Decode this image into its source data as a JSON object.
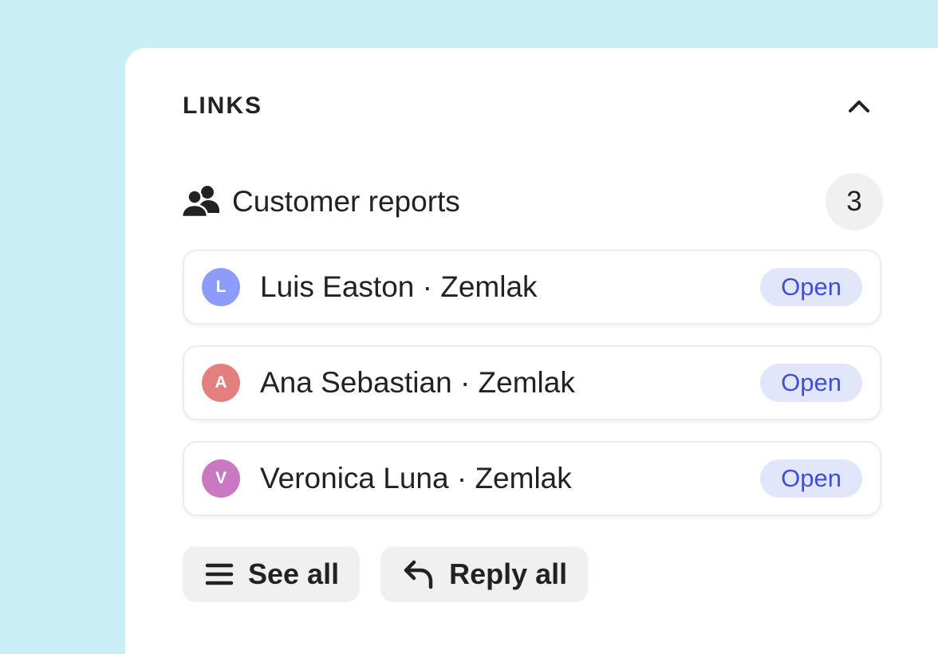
{
  "colors": {
    "page_background": "#c9eef5",
    "panel_background": "#ffffff",
    "open_button_bg": "#e1e6fb",
    "open_button_text": "#3d50d6",
    "action_button_bg": "#f0f0f0"
  },
  "section": {
    "title": "LINKS",
    "collapse_icon": "chevron-up-icon"
  },
  "group": {
    "icon": "users-icon",
    "title": "Customer reports",
    "count": "3"
  },
  "reports": [
    {
      "initial": "L",
      "avatar_color": "#8e9cf9",
      "name": "Luis Easton · Zemlak",
      "action": "Open"
    },
    {
      "initial": "A",
      "avatar_color": "#e47f7f",
      "name": "Ana Sebastian · Zemlak",
      "action": "Open"
    },
    {
      "initial": "V",
      "avatar_color": "#c979c2",
      "name": "Veronica Luna · Zemlak",
      "action": "Open"
    }
  ],
  "actions": {
    "see_all": {
      "icon": "list-icon",
      "label": "See all"
    },
    "reply_all": {
      "icon": "reply-icon",
      "label": "Reply all"
    }
  }
}
